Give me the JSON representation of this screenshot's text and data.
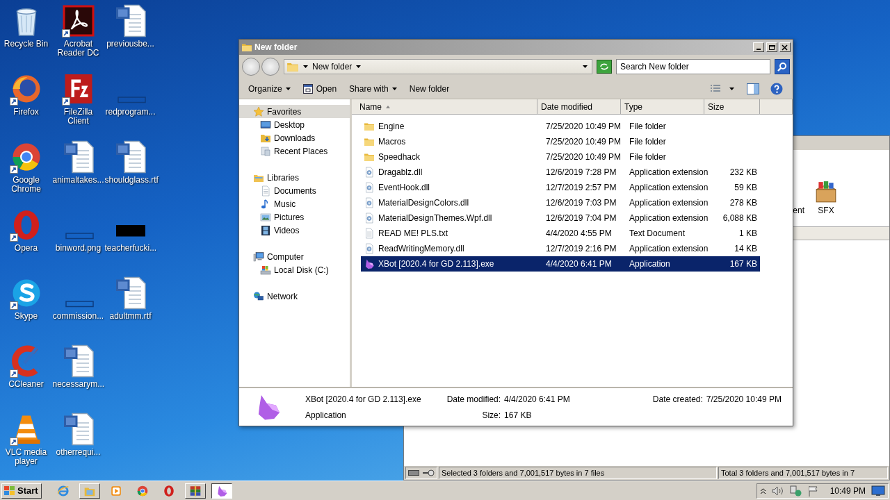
{
  "desktop_icons": [
    {
      "label": "Recycle Bin",
      "kind": "recycle",
      "shortcut": false
    },
    {
      "label": "Firefox",
      "kind": "firefox",
      "shortcut": true
    },
    {
      "label": "Google Chrome",
      "kind": "chrome",
      "shortcut": true
    },
    {
      "label": "Opera",
      "kind": "opera",
      "shortcut": true
    },
    {
      "label": "Skype",
      "kind": "skype",
      "shortcut": true
    },
    {
      "label": "CCleaner",
      "kind": "ccleaner",
      "shortcut": true
    },
    {
      "label": "VLC media player",
      "kind": "vlc",
      "shortcut": true
    },
    {
      "label": "Acrobat Reader DC",
      "kind": "acrobat",
      "shortcut": true
    },
    {
      "label": "FileZilla Client",
      "kind": "filezilla",
      "shortcut": true
    },
    {
      "label": "animaltakes...",
      "kind": "word",
      "shortcut": false
    },
    {
      "label": "binword.png",
      "kind": "blankthumb",
      "shortcut": false
    },
    {
      "label": "commission...",
      "kind": "blankthumb",
      "shortcut": false
    },
    {
      "label": "necessarym...",
      "kind": "word",
      "shortcut": false
    },
    {
      "label": "otherrequi...",
      "kind": "word",
      "shortcut": false
    },
    {
      "label": "previousbe...",
      "kind": "word",
      "shortcut": false
    },
    {
      "label": "redprogram...",
      "kind": "blankthumb",
      "shortcut": false
    },
    {
      "label": "shouldglass.rtf",
      "kind": "word",
      "shortcut": false
    },
    {
      "label": "teacherfucki...",
      "kind": "blackthumb",
      "shortcut": false
    },
    {
      "label": "adultmm.rtf",
      "kind": "word",
      "shortcut": false
    }
  ],
  "background_window": {
    "toolbar": [
      {
        "label": "ent",
        "kind": "text"
      },
      {
        "label": "SFX",
        "kind": "sfx"
      }
    ],
    "status_left": "Selected 3 folders and 7,001,517 bytes in 7 files",
    "status_right": "Total 3 folders and 7,001,517 bytes in 7"
  },
  "explorer": {
    "title": "New folder",
    "address": "New folder",
    "search": {
      "placeholder": "Search New folder"
    },
    "commands": [
      {
        "label": "Organize",
        "kind": "menu"
      },
      {
        "label": "Open",
        "kind": "open"
      },
      {
        "label": "Share with",
        "kind": "menu"
      },
      {
        "label": "New folder",
        "kind": "plain"
      }
    ],
    "nav": [
      {
        "label": "Favorites",
        "kind": "star",
        "selected": true,
        "children": [
          {
            "label": "Desktop",
            "kind": "desktop",
            "selected": false
          },
          {
            "label": "Downloads",
            "kind": "downloads",
            "selected": false
          },
          {
            "label": "Recent Places",
            "kind": "recent",
            "selected": false
          }
        ]
      },
      {
        "label": "Libraries",
        "kind": "libraries",
        "selected": false,
        "children": [
          {
            "label": "Documents",
            "kind": "documents",
            "selected": false
          },
          {
            "label": "Music",
            "kind": "music",
            "selected": false
          },
          {
            "label": "Pictures",
            "kind": "pictures",
            "selected": false
          },
          {
            "label": "Videos",
            "kind": "videos",
            "selected": false
          }
        ]
      },
      {
        "label": "Computer",
        "kind": "computer",
        "selected": false,
        "children": [
          {
            "label": "Local Disk (C:)",
            "kind": "disk",
            "selected": false
          }
        ]
      },
      {
        "label": "Network",
        "kind": "network",
        "selected": false
      }
    ],
    "columns": [
      "Name",
      "Date modified",
      "Type",
      "Size"
    ],
    "files": [
      {
        "name": "Engine",
        "date": "7/25/2020 10:49 PM",
        "type": "File folder",
        "kind": "folder",
        "selected": false
      },
      {
        "name": "Macros",
        "date": "7/25/2020 10:49 PM",
        "type": "File folder",
        "kind": "folder",
        "selected": false
      },
      {
        "name": "Speedhack",
        "date": "7/25/2020 10:49 PM",
        "type": "File folder",
        "kind": "folder",
        "selected": false
      },
      {
        "name": "Dragablz.dll",
        "date": "12/6/2019 7:28 PM",
        "type": "Application extension",
        "size": "232 KB",
        "kind": "dll",
        "selected": false
      },
      {
        "name": "EventHook.dll",
        "date": "12/7/2019 2:57 PM",
        "type": "Application extension",
        "size": "59 KB",
        "kind": "dll",
        "selected": false
      },
      {
        "name": "MaterialDesignColors.dll",
        "date": "12/6/2019 7:03 PM",
        "type": "Application extension",
        "size": "278 KB",
        "kind": "dll",
        "selected": false
      },
      {
        "name": "MaterialDesignThemes.Wpf.dll",
        "date": "12/6/2019 7:04 PM",
        "type": "Application extension",
        "size": "6,088 KB",
        "kind": "dll",
        "selected": false
      },
      {
        "name": "READ ME! PLS.txt",
        "date": "4/4/2020 4:55 PM",
        "type": "Text Document",
        "size": "1 KB",
        "kind": "txt",
        "selected": false
      },
      {
        "name": "ReadWritingMemory.dll",
        "date": "12/7/2019 2:16 PM",
        "type": "Application extension",
        "size": "14 KB",
        "kind": "dll",
        "selected": false
      },
      {
        "name": "XBot [2020.4 for GD 2.113].exe",
        "date": "4/4/2020 6:41 PM",
        "type": "Application",
        "size": "167 KB",
        "kind": "xbot",
        "selected": true
      }
    ],
    "details": {
      "kind": "xbot",
      "name": "XBot [2020.4 for GD 2.113].exe",
      "type": "Application",
      "modified_label": "Date modified:",
      "modified": "4/4/2020 6:41 PM",
      "size_label": "Size:",
      "size": "167 KB",
      "created_label": "Date created:",
      "created": "7/25/2020 10:49 PM"
    }
  },
  "taskbar": {
    "start": "Start",
    "apps": [
      {
        "kind": "ie",
        "running": false,
        "active": false
      },
      {
        "kind": "explorer",
        "running": true,
        "active": false
      },
      {
        "kind": "media",
        "running": false,
        "active": false
      },
      {
        "kind": "chrome",
        "running": false,
        "active": false
      },
      {
        "kind": "opera",
        "running": false,
        "active": false
      },
      {
        "kind": "winrar",
        "running": true,
        "active": false
      },
      {
        "kind": "xbot",
        "running": true,
        "active": true
      }
    ],
    "clock": "10:49 PM"
  }
}
